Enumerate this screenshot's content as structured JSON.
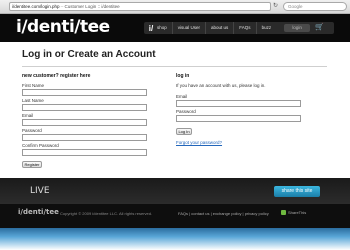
{
  "browser": {
    "url": "i/dentitee.com/login.php",
    "page_title": "Customer Login :: i/dentitee",
    "search_placeholder": "Google"
  },
  "header": {
    "logo": "i/denti/tee",
    "nav": [
      "shop",
      "visual User",
      "about us",
      "FAQs",
      "buzz"
    ],
    "login_label": "login"
  },
  "page": {
    "title": "Log in or Create an Account"
  },
  "register": {
    "heading": "new customer? register here",
    "fields": [
      "First Name",
      "Last Name",
      "Email",
      "Password",
      "Confirm Password"
    ],
    "button": "Register"
  },
  "login": {
    "heading": "log in",
    "intro": "If you have an account with us, please log in.",
    "email_label": "Email",
    "password_label": "Password",
    "button": "Log In",
    "forgot": "Forgot your password?"
  },
  "footer": {
    "live_logo": "LIVE",
    "share_button": "share this site",
    "logo": "i/denti/tee",
    "copyright": "Copyright © 2009 i/dentitee LLC. All rights reserved.",
    "links": "FAQs | contact us | exchange policy | privacy policy",
    "sharethis": "ShareThis"
  }
}
